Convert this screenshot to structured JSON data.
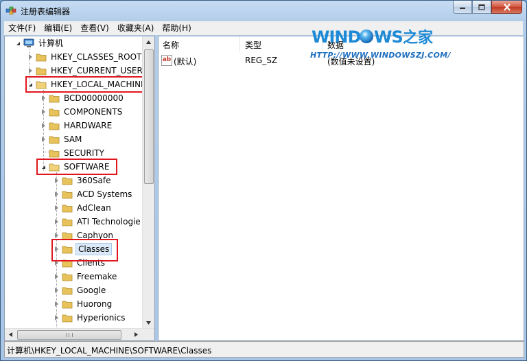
{
  "window": {
    "title": "注册表编辑器",
    "controls": {
      "minimize": "minimize",
      "maximize": "maximize",
      "close": "close"
    }
  },
  "menu": {
    "items": [
      {
        "label": "文件(F)"
      },
      {
        "label": "编辑(E)"
      },
      {
        "label": "查看(V)"
      },
      {
        "label": "收藏夹(A)"
      },
      {
        "label": "帮助(H)"
      }
    ]
  },
  "watermark": {
    "name": "WIND WS之家",
    "url": "HTTP://WWW.WINDOWSZJ.COM/"
  },
  "tree": {
    "root": "计算机",
    "items": [
      {
        "label": "HKEY_CLASSES_ROOT",
        "state": "collapsed"
      },
      {
        "label": "HKEY_CURRENT_USER",
        "state": "collapsed"
      },
      {
        "label": "HKEY_LOCAL_MACHINE",
        "state": "expanded"
      },
      {
        "label": "BCD00000000",
        "state": "collapsed"
      },
      {
        "label": "COMPONENTS",
        "state": "collapsed"
      },
      {
        "label": "HARDWARE",
        "state": "collapsed"
      },
      {
        "label": "SAM",
        "state": "collapsed"
      },
      {
        "label": "SECURITY",
        "state": "none"
      },
      {
        "label": "SOFTWARE",
        "state": "expanded"
      },
      {
        "label": "360Safe",
        "state": "collapsed"
      },
      {
        "label": "ACD Systems",
        "state": "collapsed"
      },
      {
        "label": "AdClean",
        "state": "collapsed"
      },
      {
        "label": "ATI Technologie",
        "state": "collapsed"
      },
      {
        "label": "Caphyon",
        "state": "collapsed"
      },
      {
        "label": "Classes",
        "state": "collapsed",
        "selected": true
      },
      {
        "label": "Clients",
        "state": "collapsed"
      },
      {
        "label": "Freemake",
        "state": "collapsed"
      },
      {
        "label": "Google",
        "state": "collapsed"
      },
      {
        "label": "Huorong",
        "state": "collapsed"
      },
      {
        "label": "Hyperionics",
        "state": "collapsed"
      }
    ]
  },
  "list": {
    "columns": [
      "名称",
      "类型",
      "数据"
    ],
    "rows": [
      {
        "name": "(默认)",
        "type": "REG_SZ",
        "data": "(数值未设置)"
      }
    ]
  },
  "status": {
    "path": "计算机\\HKEY_LOCAL_MACHINE\\SOFTWARE\\Classes"
  },
  "colors": {
    "highlight_box": "#e0161e",
    "folder": "#e8c25a",
    "selection": "#dbe9f9"
  }
}
